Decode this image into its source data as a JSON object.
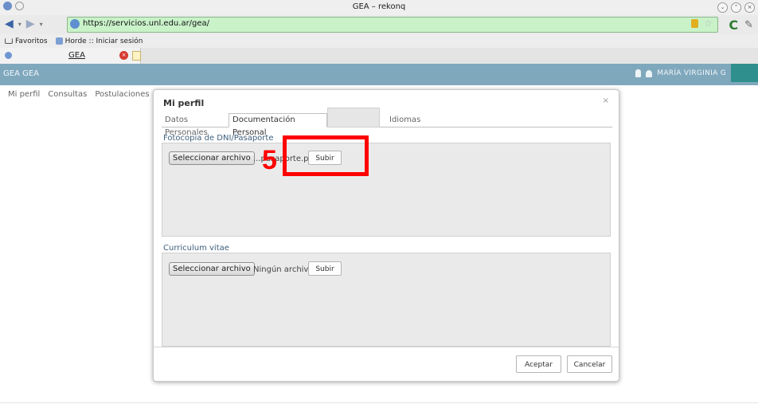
{
  "browser": {
    "window_title": "GEA – rekonq",
    "url": "https://servicios.unl.edu.ar/gea/",
    "bookmarks": [
      "Favoritos",
      "Horde :: Iniciar sesión"
    ],
    "tab_label": "GEA"
  },
  "app": {
    "brand": "GEA GEA",
    "user_name": "MARÍA VIRGINIA G",
    "menu": [
      "Mi perfil",
      "Consultas",
      "Postulaciones"
    ]
  },
  "modal": {
    "title": "Mi perfil",
    "close": "×",
    "tabs": [
      "Datos Personales",
      "Documentación Personal",
      "",
      "Idiomas"
    ],
    "sections": [
      {
        "label": "Fotocopia de DNI/Pasaporte",
        "file_button": "Seleccionar archivo",
        "file_name": "...pasaporte.pdf",
        "upload_button": "Subir"
      },
      {
        "label": "Curriculum vitae",
        "file_button": "Seleccionar archivo",
        "file_name": "Ningún archivo sele",
        "upload_button": "Subir"
      }
    ],
    "accept_button": "Aceptar",
    "cancel_button": "Cancelar"
  },
  "annotation": {
    "step_number": "5",
    "color": "#ff0000"
  },
  "colors": {
    "header": "#7fa8bd",
    "user_block": "#2f8f8c",
    "url_bar": "#c9f2c9"
  }
}
